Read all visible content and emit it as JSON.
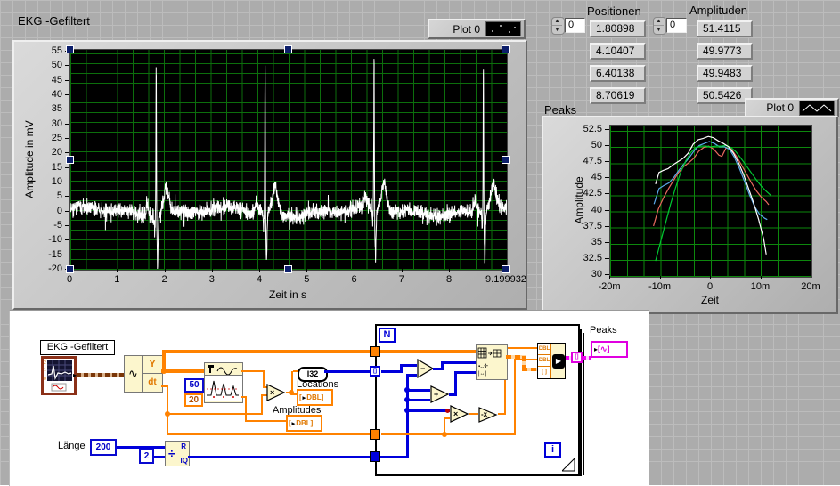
{
  "front_panel": {
    "ekg_graph": {
      "title": "EKG -Gefiltert",
      "legend_label": "Plot 0",
      "xlabel": "Zeit in s",
      "ylabel": "Amplitude in mV",
      "x_ticks": [
        "0",
        "1",
        "2",
        "3",
        "4",
        "5",
        "6",
        "7",
        "8",
        "9.199932"
      ],
      "y_ticks": [
        "55",
        "50",
        "45",
        "40",
        "35",
        "30",
        "25",
        "20",
        "15",
        "10",
        "5",
        "0",
        "-5",
        "-10",
        "-15",
        "-20"
      ]
    },
    "positionen": {
      "label": "Positionen",
      "index": "0",
      "values": [
        "1.80898",
        "4.10407",
        "6.40138",
        "8.70619"
      ]
    },
    "amplituden": {
      "label": "Amplituden",
      "index": "0",
      "values": [
        "51.4115",
        "49.9773",
        "49.9483",
        "50.5426"
      ]
    },
    "peaks_graph": {
      "title": "Peaks",
      "legend_label": "Plot 0",
      "xlabel": "Zeit",
      "ylabel": "Amplitude",
      "x_ticks": [
        "-20m",
        "-10m",
        "0",
        "10m",
        "20m"
      ],
      "y_ticks": [
        "52.5",
        "50",
        "47.5",
        "45",
        "42.5",
        "40",
        "37.5",
        "35",
        "32.5",
        "30"
      ]
    }
  },
  "chart_data": [
    {
      "type": "line",
      "title": "EKG -Gefiltert",
      "xlabel": "Zeit in s",
      "ylabel": "Amplitude in mV",
      "xlim": [
        0,
        9.199932
      ],
      "ylim": [
        -20,
        55
      ],
      "grid": true,
      "line_color": "#ffffff",
      "background": "#000000",
      "grid_color": "#0c6e0c",
      "description": "Noisy filtered ECG trace: baseline noise around 0 mV (about ±5 mV), QRS spikes at the peak positions with undershoot to about -16 mV and T-wave bumps of about +9 mV after each spike",
      "peak_positions": [
        1.80898,
        4.10407,
        6.40138,
        8.70619
      ],
      "peak_amplitudes": [
        51.4115,
        49.9773,
        49.9483,
        50.5426
      ],
      "noise_amplitude": 4,
      "undershoot": -16,
      "t_wave_height": 9
    },
    {
      "type": "line",
      "title": "Peaks",
      "xlabel": "Zeit",
      "ylabel": "Amplitude",
      "xlim": [
        -20,
        20
      ],
      "x_unit": "m",
      "ylim": [
        29.7,
        53.2
      ],
      "grid": true,
      "background": "#000000",
      "grid_color": "#0d870d",
      "legend_position": "top-right",
      "series": [
        {
          "name": "peak-red",
          "color": "#e96a5f",
          "points": [
            [
              -11.4,
              37.6
            ],
            [
              -10.4,
              40.3
            ],
            [
              -9.4,
              42.0
            ],
            [
              -8.4,
              43.4
            ],
            [
              -7.4,
              44.7
            ],
            [
              -6.4,
              45.9
            ],
            [
              -5.4,
              46.8
            ],
            [
              -4.4,
              47.4
            ],
            [
              -3.4,
              48.1
            ],
            [
              -2.4,
              49.2
            ],
            [
              -1.4,
              49.8
            ],
            [
              -0.4,
              50.0
            ],
            [
              0.6,
              49.5
            ],
            [
              1.6,
              48.6
            ],
            [
              2.2,
              48.4
            ],
            [
              3,
              49.7
            ],
            [
              4,
              49.6
            ],
            [
              5,
              48.5
            ],
            [
              6,
              47.2
            ],
            [
              7,
              45.8
            ],
            [
              8,
              44.4
            ],
            [
              9,
              43.1
            ],
            [
              10,
              42.1
            ],
            [
              11,
              41.4
            ],
            [
              11.5,
              40.9
            ]
          ]
        },
        {
          "name": "peak-blue",
          "color": "#5aa8e8",
          "points": [
            [
              -11.3,
              41.0
            ],
            [
              -10.3,
              43.4
            ],
            [
              -9.3,
              43.9
            ],
            [
              -8.3,
              44.3
            ],
            [
              -7.3,
              45.2
            ],
            [
              -6.3,
              46.3
            ],
            [
              -5.3,
              47.3
            ],
            [
              -4.3,
              48.2
            ],
            [
              -3.3,
              49.3
            ],
            [
              -2.3,
              50.1
            ],
            [
              -1.3,
              50.4
            ],
            [
              -0.3,
              50.7
            ],
            [
              0.7,
              50.4
            ],
            [
              1.7,
              49.9
            ],
            [
              2.7,
              49.9
            ],
            [
              3.7,
              49.5
            ],
            [
              4.7,
              48.2
            ],
            [
              5.7,
              46.5
            ],
            [
              6.7,
              44.5
            ],
            [
              7.7,
              42.4
            ],
            [
              8.7,
              40.6
            ],
            [
              9.7,
              39.4
            ],
            [
              10.7,
              38.8
            ],
            [
              11.2,
              38.6
            ]
          ]
        },
        {
          "name": "peak-green",
          "color": "#00c832",
          "points": [
            [
              -11,
              32.2
            ],
            [
              -10,
              35.1
            ],
            [
              -9,
              38.1
            ],
            [
              -8,
              41.0
            ],
            [
              -7,
              43.6
            ],
            [
              -6,
              45.9
            ],
            [
              -5,
              47.7
            ],
            [
              -4,
              49.0
            ],
            [
              -3,
              49.8
            ],
            [
              -2,
              50.0
            ],
            [
              -1,
              50.0
            ],
            [
              0,
              49.9
            ],
            [
              1,
              50.0
            ],
            [
              2,
              50.0
            ],
            [
              3,
              50.1
            ],
            [
              4,
              49.8
            ],
            [
              5,
              49.1
            ],
            [
              6,
              48.1
            ],
            [
              7,
              47.0
            ],
            [
              8,
              45.9
            ],
            [
              9,
              44.8
            ],
            [
              10,
              43.8
            ],
            [
              11,
              43.0
            ],
            [
              12,
              42.3
            ]
          ]
        },
        {
          "name": "peak-white",
          "color": "#ffffff",
          "points": [
            [
              -11,
              44.1
            ],
            [
              -10.3,
              45.9
            ],
            [
              -9.5,
              46.2
            ],
            [
              -8.5,
              46.5
            ],
            [
              -7.5,
              47.1
            ],
            [
              -6.5,
              47.6
            ],
            [
              -5.5,
              48.1
            ],
            [
              -4.5,
              48.9
            ],
            [
              -3.5,
              50.3
            ],
            [
              -2.5,
              51.0
            ],
            [
              -1.5,
              51.2
            ],
            [
              -0.5,
              51.5
            ],
            [
              0.5,
              51.3
            ],
            [
              1.5,
              50.8
            ],
            [
              2.5,
              50.4
            ],
            [
              3.5,
              49.9
            ],
            [
              4.5,
              48.9
            ],
            [
              5.5,
              47.4
            ],
            [
              6.5,
              45.6
            ],
            [
              7.5,
              43.4
            ],
            [
              8.5,
              41.2
            ],
            [
              9.5,
              38.6
            ],
            [
              10.5,
              35.6
            ],
            [
              11,
              33.2
            ]
          ]
        }
      ]
    }
  ],
  "block_diagram": {
    "ekg_terminal_label": "EKG -Gefiltert",
    "wfm_component_y": "Y",
    "wfm_component_dt": "dt",
    "wfm_glyph": "∿",
    "const_width": "50",
    "const_threshold": "20",
    "i32_label": "I32",
    "locations_label": "Locations",
    "amplitudes_label": "Amplitudes",
    "dbl_label": "DBL",
    "laenge_label": "Länge",
    "const_laenge": "200",
    "const_divisor": "2",
    "quotient_div": "÷",
    "quotient_r": "R",
    "quotient_iq": "IQ",
    "loop_count": "N",
    "loop_iteration": "i",
    "autoindex_glyph": "[]",
    "bundle_rows": [
      "DBL",
      "DBL",
      "[ ]"
    ],
    "bundle_arrow": "▶",
    "op_subtract": "−",
    "op_add": "+",
    "op_multiply": "×",
    "op_negate": "-x",
    "peaks_label": "Peaks",
    "peaks_indicator_glyph": "[∿]",
    "output_nub": "▸"
  },
  "colors": {
    "wire_dbl_orange": "#ff8200",
    "wire_int_blue": "#0000dc",
    "wire_cluster_magenta": "#f000f0",
    "wire_waveform_brown": "#7a3608",
    "node_fill": "#fcf6cd",
    "panel_gray": "#acacac",
    "plot_grid_green": "#0c6e0c",
    "selection_handle_navy": "#0d1f6b"
  }
}
